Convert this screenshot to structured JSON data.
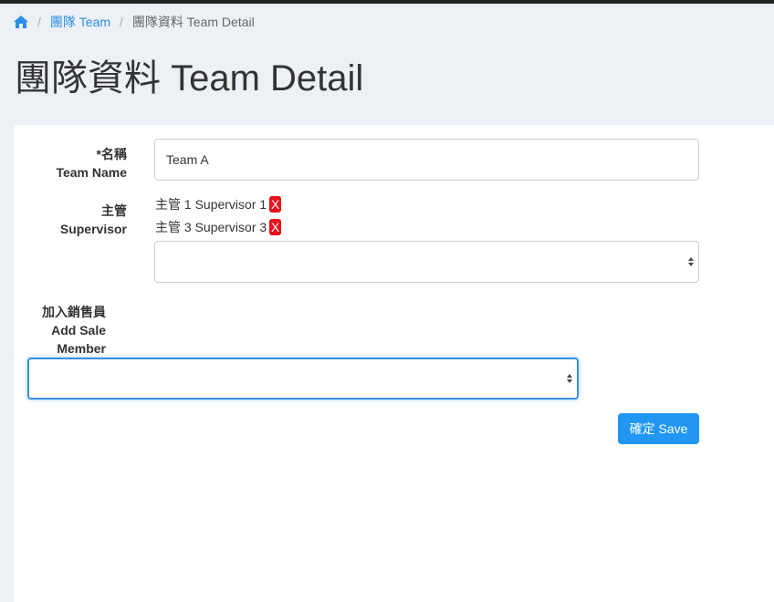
{
  "breadcrumb": {
    "home_icon": "home-icon",
    "team_link": "團隊 Team",
    "current": "團隊資料 Team Detail"
  },
  "page": {
    "title": "團隊資料 Team Detail"
  },
  "form": {
    "name_label_line1": "*名稱",
    "name_label_line2": "Team Name",
    "name_value": "Team A",
    "supervisor_label_line1": "主管",
    "supervisor_label_line2": "Supervisor",
    "supervisors": [
      {
        "name": "主管 1 Supervisor 1",
        "remove": "X"
      },
      {
        "name": "主管 3 Supervisor 3",
        "remove": "X"
      }
    ],
    "supervisor_select_value": "",
    "sale_label_line1": "加入銷售員",
    "sale_label_line2": "Add Sale",
    "sale_label_line3": "Member",
    "sale_select_value": "",
    "save_label": "確定 Save"
  },
  "colors": {
    "accent": "#2196f3",
    "remove": "#e8101c",
    "background": "#edf0f5"
  }
}
